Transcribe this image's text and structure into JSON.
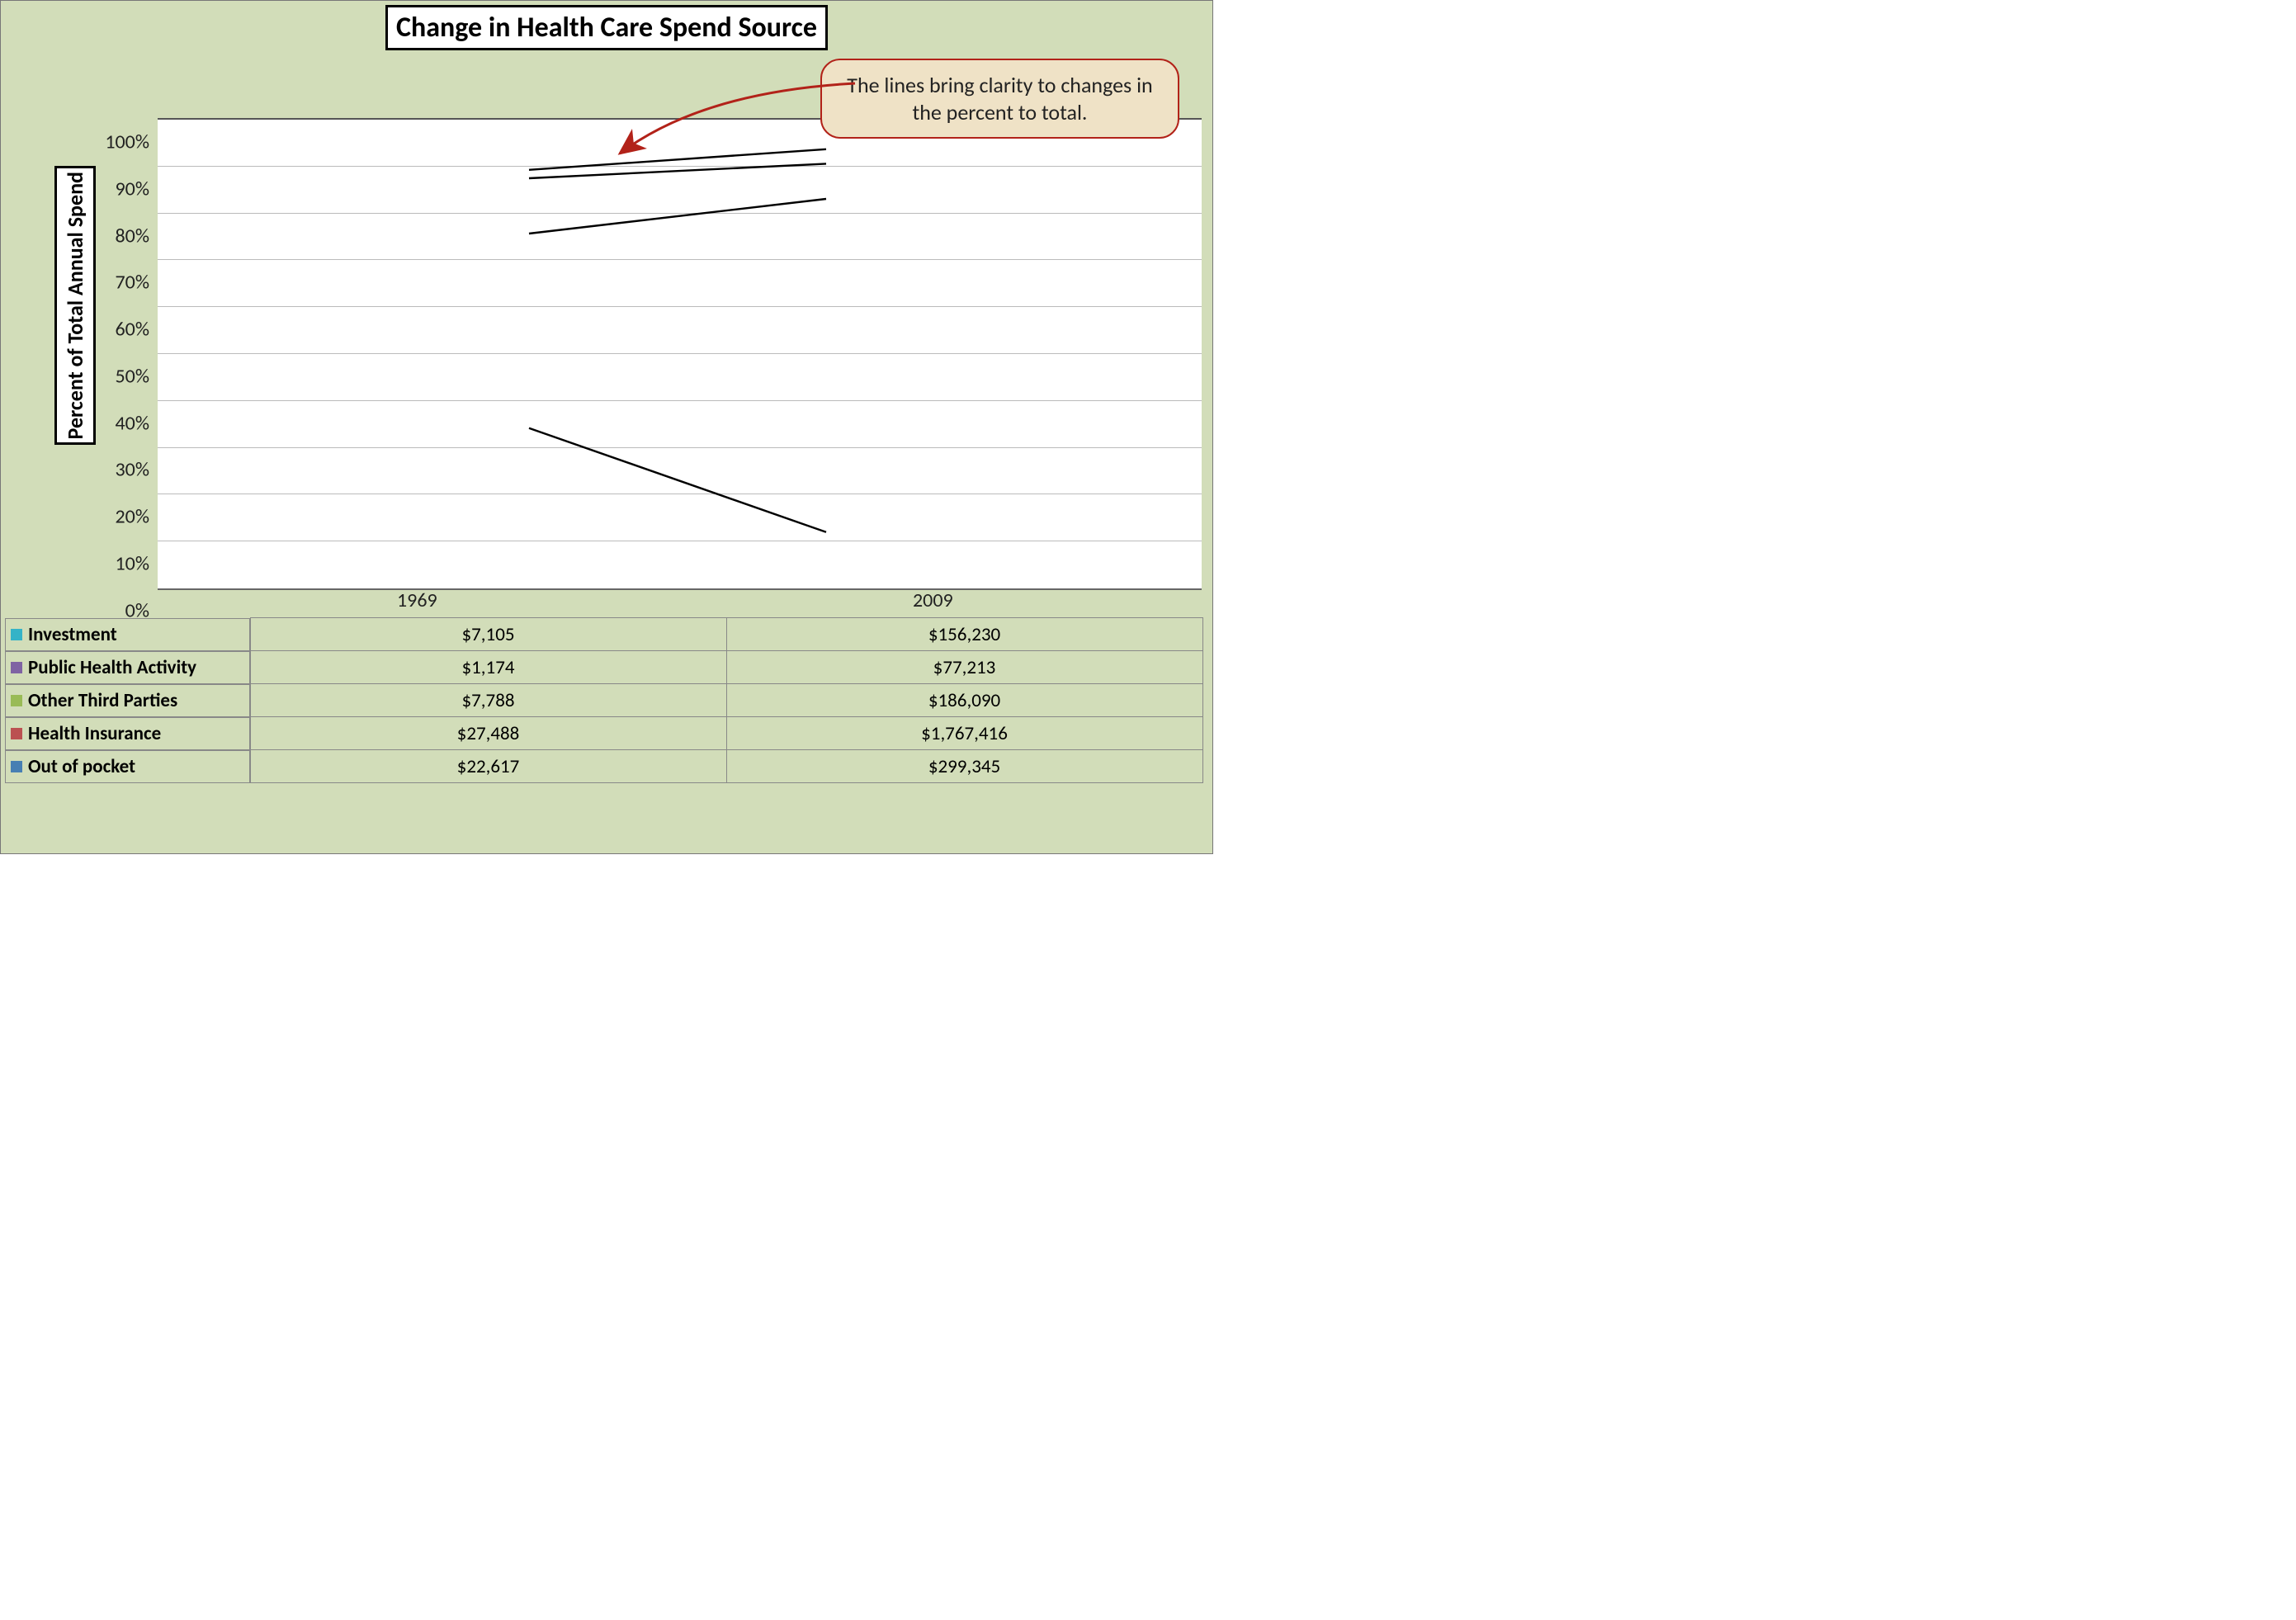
{
  "title": "Change in Health Care Spend Source",
  "ylabel": "Percent of Total Annual Spend",
  "callout": "The lines bring clarity to changes in the percent to total.",
  "ticks": [
    "0%",
    "10%",
    "20%",
    "30%",
    "40%",
    "50%",
    "60%",
    "70%",
    "80%",
    "90%",
    "100%"
  ],
  "categories": [
    "1969",
    "2009"
  ],
  "series": [
    {
      "name": "Investment",
      "color": "#34b3c7",
      "values": [
        "$7,105",
        "$156,230"
      ]
    },
    {
      "name": "Public Health Activity",
      "color": "#7f63a3",
      "values": [
        "$1,174",
        "$77,213"
      ]
    },
    {
      "name": "Other Third Parties",
      "color": "#99bb56",
      "values": [
        "$7,788",
        "$186,090"
      ]
    },
    {
      "name": "Health Insurance",
      "color": "#bb5151",
      "values": [
        "$27,488",
        "$1,767,416"
      ]
    },
    {
      "name": "Out of pocket",
      "color": "#477fb3",
      "values": [
        "$22,617",
        "$299,345"
      ]
    }
  ],
  "chart_data": {
    "type": "bar",
    "stacking": "percent",
    "title": "Change in Health Care Spend Source",
    "xlabel": "",
    "ylabel": "Percent of Total Annual Spend",
    "ylim": [
      0,
      100
    ],
    "categories": [
      "1969",
      "2009"
    ],
    "series": [
      {
        "name": "Out of pocket",
        "color": "#477fb3",
        "raw": [
          22617,
          299345
        ],
        "percent": [
          34.2,
          12.0
        ]
      },
      {
        "name": "Health Insurance",
        "color": "#bb5151",
        "raw": [
          27488,
          1767416
        ],
        "percent": [
          41.5,
          71.1
        ]
      },
      {
        "name": "Other Third Parties",
        "color": "#99bb56",
        "raw": [
          7788,
          186090
        ],
        "percent": [
          11.8,
          7.5
        ]
      },
      {
        "name": "Public Health Activity",
        "color": "#7f63a3",
        "raw": [
          1174,
          77213
        ],
        "percent": [
          1.8,
          3.1
        ]
      },
      {
        "name": "Investment",
        "color": "#34b3c7",
        "raw": [
          7105,
          156230
        ],
        "percent": [
          10.7,
          6.3
        ]
      }
    ],
    "cumulative_boundaries": {
      "1969": [
        34.2,
        75.7,
        87.5,
        89.3,
        100
      ],
      "2009": [
        12.0,
        83.1,
        90.6,
        93.7,
        100
      ]
    },
    "connector_lines": true,
    "annotation": "The lines bring clarity to changes in the percent to total."
  }
}
